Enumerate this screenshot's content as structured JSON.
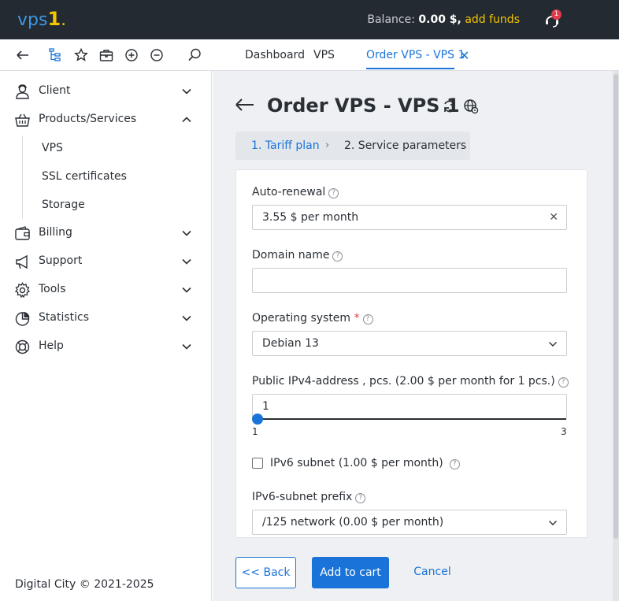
{
  "header": {
    "logo_text": "vps",
    "logo_digit": "1",
    "logo_dot": ".",
    "balance_label": "Balance:",
    "balance_amount": "0.00 $,",
    "add_funds": "add funds",
    "notifications_count": "1",
    "colors": {
      "background": "#232a31",
      "accent": "#f5c500",
      "brand": "#3f96e4"
    }
  },
  "toolbar": {
    "icons": [
      "back-icon",
      "tree-icon",
      "star-icon",
      "briefcase-icon",
      "zoom-in-icon",
      "zoom-out-icon",
      "search-icon"
    ],
    "breadcrumbs": [
      {
        "label": "Dashboard"
      },
      {
        "label": "VPS"
      },
      {
        "label": "Order VPS - VPS 1",
        "active": true
      }
    ]
  },
  "sidebar": {
    "items": [
      {
        "label": "Client",
        "icon": "user-icon",
        "expanded": false
      },
      {
        "label": "Products/Services",
        "icon": "basket-icon",
        "expanded": true
      },
      {
        "label": "Billing",
        "icon": "wallet-icon",
        "expanded": false
      },
      {
        "label": "Support",
        "icon": "megaphone-icon",
        "expanded": false
      },
      {
        "label": "Tools",
        "icon": "gear-icon",
        "expanded": false
      },
      {
        "label": "Statistics",
        "icon": "pie-chart-icon",
        "expanded": false
      },
      {
        "label": "Help",
        "icon": "lifebuoy-icon",
        "expanded": false
      }
    ],
    "subitems": [
      {
        "label": "VPS"
      },
      {
        "label": "SSL certificates"
      },
      {
        "label": "Storage"
      }
    ],
    "footer": "Digital City © 2021-2025"
  },
  "main": {
    "title": "Order VPS - VPS 1",
    "steps": {
      "step1": "1. Tariff plan",
      "separator": "›",
      "step2": "2. Service parameters"
    },
    "form": {
      "auto_renewal": {
        "label": "Auto-renewal",
        "value": "3.55 $ per month"
      },
      "domain_name": {
        "label": "Domain name",
        "value": ""
      },
      "os": {
        "label": "Operating system",
        "required": "*",
        "value": "Debian 13"
      },
      "ipv4": {
        "label": "Public IPv4-address , pcs. (2.00 $ per month for 1 pcs.)",
        "value": "1",
        "min": "1",
        "max": "3"
      },
      "ipv6_subnet": {
        "label": "IPv6 subnet (1.00 $ per month)",
        "checked": false
      },
      "ipv6_prefix": {
        "label": "IPv6-subnet prefix",
        "value": "/125 network (0.00 $ per month)"
      }
    },
    "buttons": {
      "back": "<< Back",
      "add_to_cart": "Add to cart",
      "cancel": "Cancel"
    },
    "help_glyph": "?",
    "clear_glyph": "✕",
    "close_tab_glyph": "✕"
  }
}
